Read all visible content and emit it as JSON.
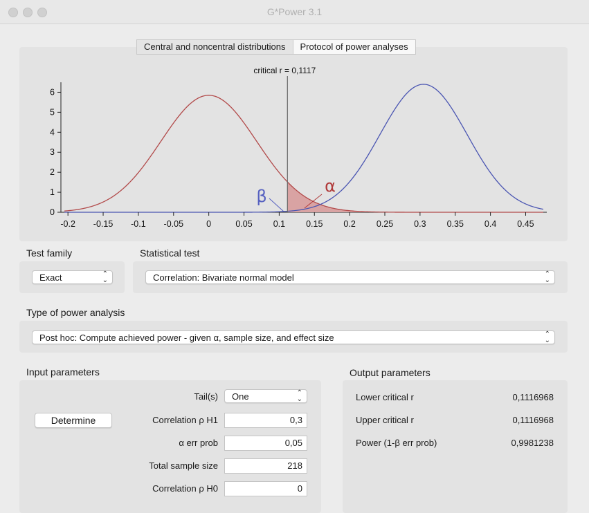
{
  "window": {
    "title": "G*Power 3.1"
  },
  "tabs": [
    {
      "label": "Central and noncentral distributions",
      "active": true
    },
    {
      "label": "Protocol of power analyses",
      "active": false
    }
  ],
  "chart_data": {
    "type": "line",
    "annotation": "critical r = 0,1117",
    "critical_r": 0.1117,
    "xlim": [
      -0.21,
      0.48
    ],
    "ylim": [
      0,
      6.5
    ],
    "x_ticks": [
      "-0.2",
      "-0.15",
      "-0.1",
      "-0.05",
      "0",
      "0.05",
      "0.1",
      "0.15",
      "0.2",
      "0.25",
      "0.3",
      "0.35",
      "0.4",
      "0.45"
    ],
    "x_tick_values": [
      -0.2,
      -0.15,
      -0.1,
      -0.05,
      0,
      0.05,
      0.1,
      0.15,
      0.2,
      0.25,
      0.3,
      0.35,
      0.4,
      0.45
    ],
    "y_ticks": [
      "0",
      "1",
      "2",
      "3",
      "4",
      "5",
      "6"
    ],
    "y_tick_values": [
      0,
      1,
      2,
      3,
      4,
      5,
      6
    ],
    "series": [
      {
        "color": "#b24a4a",
        "distribution": "central",
        "mean": 0.0,
        "sd": 0.068,
        "peak": 5.85
      },
      {
        "color": "#4a55b2",
        "distribution": "noncentral",
        "mean": 0.305,
        "sd": 0.062,
        "peak": 6.4
      }
    ],
    "beta_label": "β",
    "alpha_label": "α",
    "beta_color": "#5560c0",
    "alpha_color": "#b03a3a"
  },
  "test_family": {
    "label": "Test family",
    "value": "Exact"
  },
  "statistical_test": {
    "label": "Statistical test",
    "value": "Correlation: Bivariate normal model"
  },
  "power_analysis": {
    "label": "Type of power analysis",
    "value": "Post hoc: Compute achieved power - given α, sample size, and effect size"
  },
  "input": {
    "header": "Input parameters",
    "determine_label": "Determine",
    "tails_label": "Tail(s)",
    "tails_value": "One",
    "rho_h1_label": "Correlation ρ H1",
    "rho_h1_value": "0,3",
    "alpha_label": "α err prob",
    "alpha_value": "0,05",
    "n_label": "Total sample size",
    "n_value": "218",
    "rho_h0_label": "Correlation ρ H0",
    "rho_h0_value": "0"
  },
  "output": {
    "header": "Output parameters",
    "rows": [
      {
        "label": "Lower critical r",
        "value": "0,1116968"
      },
      {
        "label": "Upper critical r",
        "value": "0,1116968"
      },
      {
        "label": "Power (1-β err prob)",
        "value": "0,9981238"
      }
    ]
  }
}
